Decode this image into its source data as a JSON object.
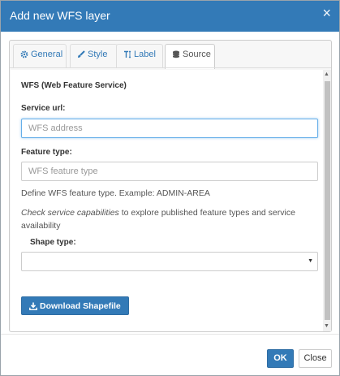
{
  "dialog": {
    "title": "Add new WFS layer",
    "close_glyph": "×"
  },
  "tabs": [
    {
      "label": "General",
      "icon": "gear-icon",
      "active": false
    },
    {
      "label": "Style",
      "icon": "brush-icon",
      "active": false
    },
    {
      "label": "Label",
      "icon": "text-height-icon",
      "active": false
    },
    {
      "label": "Source",
      "icon": "database-icon",
      "active": true
    }
  ],
  "source": {
    "section_title": "WFS (Web Feature Service)",
    "service_url": {
      "label": "Service url:",
      "placeholder": "WFS address",
      "value": ""
    },
    "feature_type": {
      "label": "Feature type:",
      "placeholder": "WFS feature type",
      "value": ""
    },
    "feature_type_help": "Define WFS feature type. Example: ADMIN-AREA",
    "capabilities_link": "Check service capabilities",
    "capabilities_text": " to explore published feature types and service availability",
    "shape_type": {
      "label": "Shape type:",
      "value": ""
    },
    "download_button": "Download Shapefile"
  },
  "footer": {
    "ok_label": "OK",
    "close_label": "Close"
  },
  "colors": {
    "header": "#337ab7",
    "primary_button": "#337ab7",
    "focus_border": "#66afe9"
  }
}
